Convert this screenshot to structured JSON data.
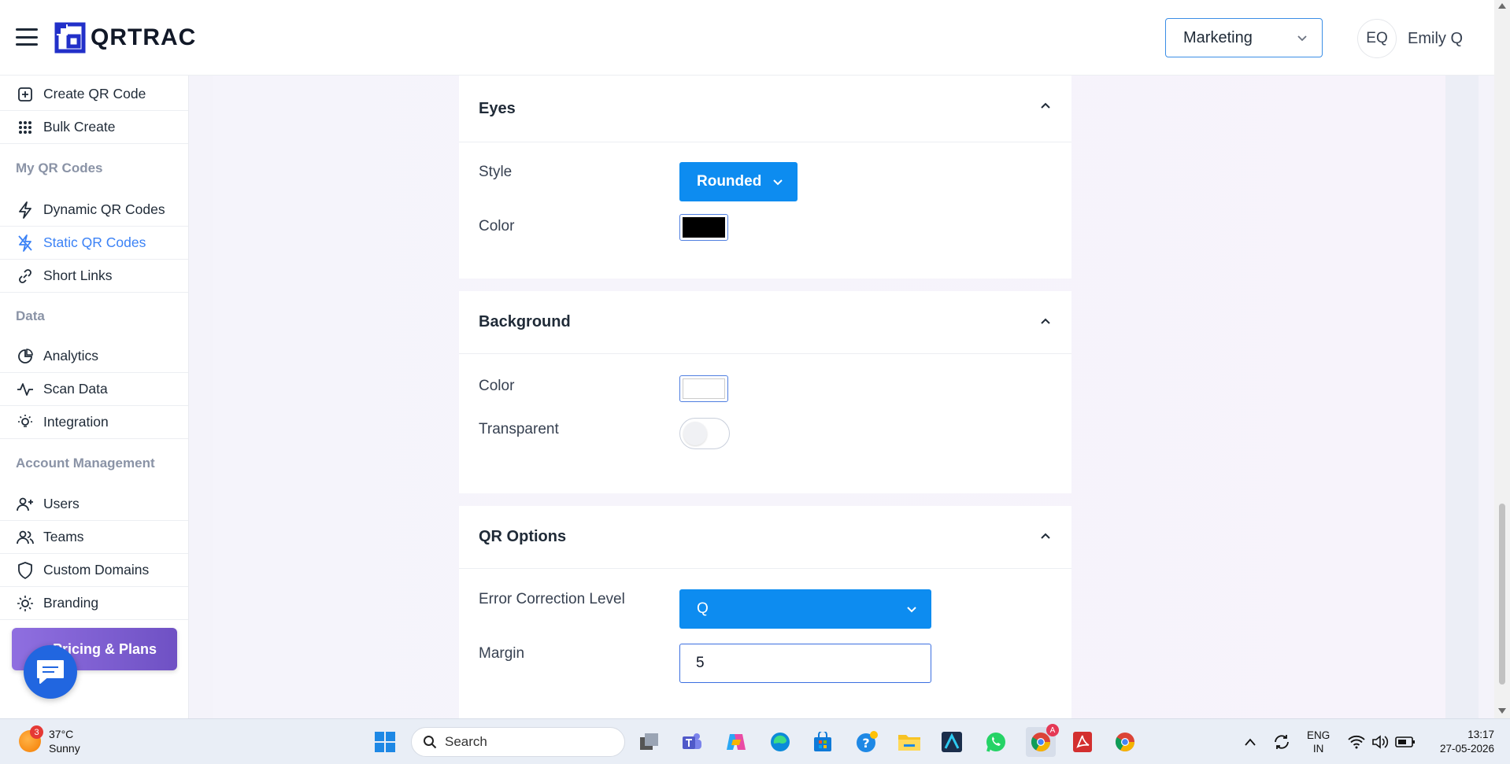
{
  "header": {
    "brand": "QRTRAC",
    "team_select": "Marketing",
    "user_initials": "EQ",
    "user_name": "Emily Q"
  },
  "sidebar": {
    "items_top": [
      {
        "label": "Create QR Code",
        "icon": "plus-square-icon"
      },
      {
        "label": "Bulk Create",
        "icon": "grid-dots-icon"
      }
    ],
    "section_my_codes": "My QR Codes",
    "items_codes": [
      {
        "label": "Dynamic QR Codes",
        "icon": "lightning-icon"
      },
      {
        "label": "Static QR Codes",
        "icon": "lightning-off-icon",
        "active": true
      },
      {
        "label": "Short Links",
        "icon": "link-icon"
      }
    ],
    "section_data": "Data",
    "items_data": [
      {
        "label": "Analytics",
        "icon": "pie-chart-icon"
      },
      {
        "label": "Scan Data",
        "icon": "activity-icon"
      },
      {
        "label": "Integration",
        "icon": "bulb-icon"
      }
    ],
    "section_account": "Account Management",
    "items_account": [
      {
        "label": "Users",
        "icon": "user-plus-icon"
      },
      {
        "label": "Teams",
        "icon": "users-icon"
      },
      {
        "label": "Custom Domains",
        "icon": "shield-icon"
      },
      {
        "label": "Branding",
        "icon": "sun-icon"
      }
    ],
    "pricing_button": "Pricing & Plans"
  },
  "eyes_panel": {
    "title": "Eyes",
    "style_label": "Style",
    "style_value": "Rounded",
    "color_label": "Color",
    "color_value": "#000000"
  },
  "background_panel": {
    "title": "Background",
    "color_label": "Color",
    "color_value": "#ffffff",
    "transparent_label": "Transparent",
    "transparent_on": false
  },
  "qr_options_panel": {
    "title": "QR Options",
    "ecl_label": "Error Correction Level",
    "ecl_value": "Q",
    "margin_label": "Margin",
    "margin_value": "5"
  },
  "taskbar": {
    "weather_badge": "3",
    "temperature": "37°C",
    "condition": "Sunny",
    "search_placeholder": "Search",
    "chrome_badge": "A",
    "lang_line1": "ENG",
    "lang_line2": "IN",
    "time": "13:17",
    "date": "27-05-2026"
  },
  "colors": {
    "accent": "#0d8cf0",
    "active_nav": "#3b82f6",
    "pricing_gradient_start": "#8f6fe0",
    "pricing_gradient_end": "#6f51c4"
  }
}
